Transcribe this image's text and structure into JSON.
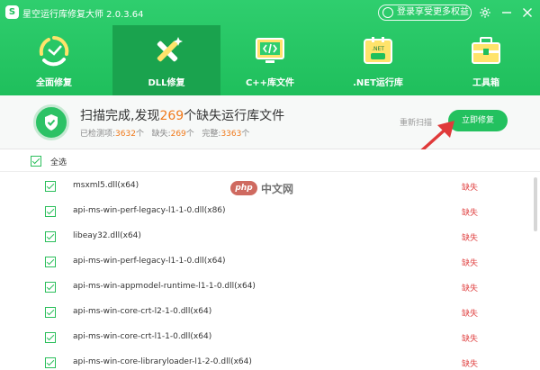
{
  "window": {
    "title": "星空运行库修复大师 2.0.3.64",
    "logo_glyph": "S",
    "vip_label": "登录享受更多权益",
    "controls": [
      "gear-icon",
      "minimize-icon",
      "close-icon"
    ]
  },
  "tabs": [
    {
      "label": "全面修复",
      "icon": "recycle-icon",
      "active": false
    },
    {
      "label": "DLL修复",
      "icon": "dll-tools-icon",
      "active": true
    },
    {
      "label": "C++库文件",
      "icon": "code-monitor-icon",
      "active": false
    },
    {
      "label": ".NET运行库",
      "icon": "dotnet-icon",
      "active": false
    },
    {
      "label": "工具箱",
      "icon": "toolbox-icon",
      "active": false
    }
  ],
  "summary": {
    "title_prefix": "扫描完成,发现",
    "missing_count": "269",
    "title_suffix": "个缺失运行库文件",
    "detected_label": "已检测项:",
    "detected_value": "3632",
    "detected_unit": "个",
    "missing_label": "缺失:",
    "missing_value": "269",
    "missing_unit": "个",
    "complete_label": "完整:",
    "complete_value": "3363",
    "complete_unit": "个",
    "rescan_label": "重新扫描",
    "repair_label": "立即修复"
  },
  "list": {
    "select_all_label": "全选",
    "rows": [
      {
        "file": "msxml5.dll(x64)",
        "status": "缺失"
      },
      {
        "file": "api-ms-win-perf-legacy-l1-1-0.dll(x86)",
        "status": "缺失"
      },
      {
        "file": "libeay32.dll(x64)",
        "status": "缺失"
      },
      {
        "file": "api-ms-win-perf-legacy-l1-1-0.dll(x64)",
        "status": "缺失"
      },
      {
        "file": "api-ms-win-appmodel-runtime-l1-1-0.dll(x64)",
        "status": "缺失"
      },
      {
        "file": "api-ms-win-core-crt-l2-1-0.dll(x64)",
        "status": "缺失"
      },
      {
        "file": "api-ms-win-core-crt-l1-1-0.dll(x64)",
        "status": "缺失"
      },
      {
        "file": "api-ms-win-core-libraryloader-l1-2-0.dll(x64)",
        "status": "缺失"
      }
    ]
  },
  "watermark": {
    "logo": "php",
    "text": "中文网"
  },
  "colors": {
    "brand": "#23c15f",
    "active_tab": "#1aa34e",
    "highlight": "#f07a1c",
    "missing": "#e04646",
    "arrow": "#e03a3a"
  }
}
